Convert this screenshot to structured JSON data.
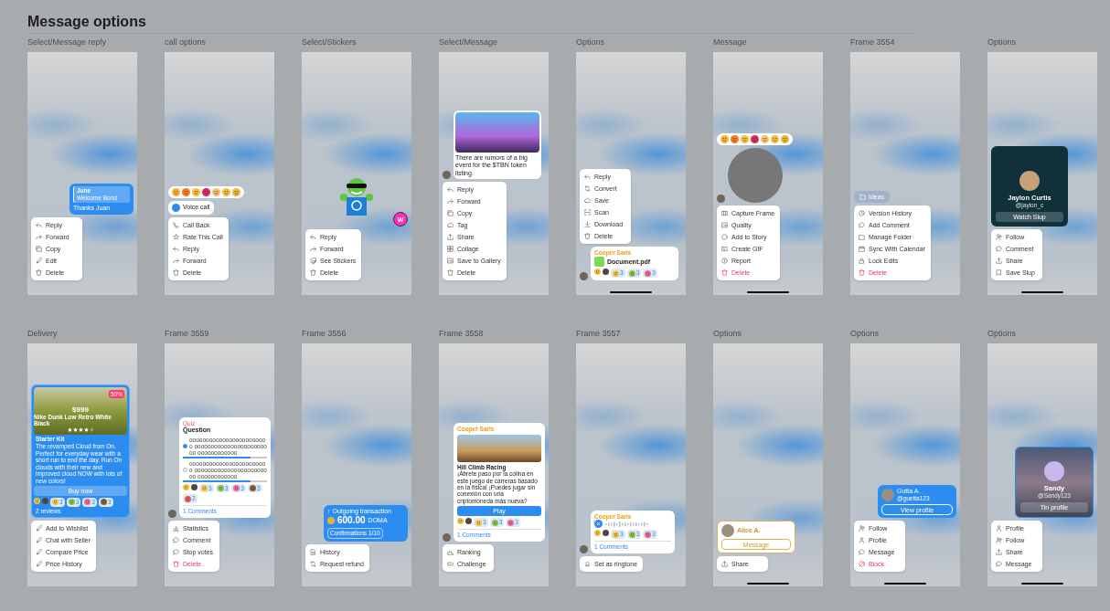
{
  "title": "Message options",
  "frames": [
    {
      "label": "Select/Message reply",
      "home_indicator": false,
      "parts": [
        {
          "kind": "reply-bubble",
          "outgoing": true,
          "quote_name": "June",
          "quote_text": "Welcome Bond",
          "text": "Thanks Juan"
        },
        {
          "kind": "menu",
          "items": [
            {
              "kind": "reply",
              "label": "Reply",
              "danger": false
            },
            {
              "kind": "forward",
              "label": "Forward",
              "danger": false
            },
            {
              "kind": "copy",
              "label": "Copy",
              "danger": false
            },
            {
              "kind": "edit",
              "label": "Edit",
              "danger": false
            },
            {
              "kind": "delete",
              "label": "Delete",
              "danger": false
            }
          ]
        }
      ]
    },
    {
      "label": "call options",
      "home_indicator": false,
      "parts": [
        {
          "kind": "reaction-bar",
          "emojis": [
            {
              "color": "#f7b733"
            },
            {
              "color": "#f57c1f"
            },
            {
              "color": "#f9c23c"
            },
            {
              "color": "#e0245e"
            },
            {
              "color": "#f5c26b"
            },
            {
              "color": "#f4c04a"
            },
            {
              "color": "#f2b63a"
            }
          ]
        },
        {
          "kind": "call-bubble",
          "outgoing": false,
          "text": "Voice call"
        },
        {
          "kind": "menu",
          "items": [
            {
              "kind": "call",
              "label": "Call Back",
              "danger": false
            },
            {
              "kind": "star",
              "label": "Rate This Call",
              "danger": false
            },
            {
              "kind": "reply",
              "label": "Reply",
              "danger": false
            },
            {
              "kind": "forward",
              "label": "Forward",
              "danger": false
            },
            {
              "kind": "delete",
              "label": "Delete",
              "danger": false
            }
          ]
        }
      ]
    },
    {
      "label": "Select/Stickers",
      "home_indicator": false,
      "parts": [
        {
          "kind": "sticker",
          "badge": "W"
        },
        {
          "kind": "menu",
          "items": [
            {
              "kind": "reply",
              "label": "Reply",
              "danger": false
            },
            {
              "kind": "forward",
              "label": "Forward",
              "danger": false
            },
            {
              "kind": "sticker",
              "label": "See Stickers",
              "danger": false
            },
            {
              "kind": "delete",
              "label": "Delete",
              "danger": false
            }
          ]
        }
      ]
    },
    {
      "label": "Select/Message",
      "home_indicator": false,
      "parts": [
        {
          "kind": "image-message",
          "outgoing": false,
          "text": "There are rumors of a big event for the $TBN token listing."
        },
        {
          "kind": "menu",
          "items": [
            {
              "kind": "reply",
              "label": "Reply",
              "danger": false
            },
            {
              "kind": "forward",
              "label": "Forward",
              "danger": false
            },
            {
              "kind": "copy",
              "label": "Copy",
              "danger": false
            },
            {
              "kind": "cloud",
              "label": "Tag",
              "danger": false
            },
            {
              "kind": "share",
              "label": "Share",
              "danger": false
            },
            {
              "kind": "collage",
              "label": "Collage",
              "danger": false
            },
            {
              "kind": "gallery",
              "label": "Save to Gallery",
              "danger": false
            },
            {
              "kind": "delete",
              "label": "Delete",
              "danger": false
            }
          ]
        }
      ]
    },
    {
      "label": "Options",
      "home_indicator": true,
      "parts": [
        {
          "kind": "menu",
          "items": [
            {
              "kind": "reply",
              "label": "Reply",
              "danger": false
            },
            {
              "kind": "convert",
              "label": "Convert",
              "danger": false
            },
            {
              "kind": "cloud",
              "label": "Save",
              "danger": false
            },
            {
              "kind": "scan",
              "label": "Scan",
              "danger": false
            },
            {
              "kind": "download",
              "label": "Download",
              "danger": false
            },
            {
              "kind": "delete",
              "label": "Delete",
              "danger": false
            }
          ]
        },
        {
          "kind": "file-message",
          "outgoing": false,
          "sender": "Cooper Saris",
          "file": "Document.pdf",
          "reactions": [
            {
              "color": "#f6c343"
            },
            {
              "color": "#4a4a4a"
            },
            {
              "color": "#f6c343",
              "count": "3"
            },
            {
              "color": "#8bc34a",
              "count": "3"
            },
            {
              "color": "#f06a9a",
              "count": "3"
            }
          ]
        }
      ]
    },
    {
      "label": "Message",
      "home_indicator": true,
      "parts": [
        {
          "kind": "reaction-bar",
          "emojis": [
            {
              "color": "#f7b733"
            },
            {
              "color": "#f57c1f"
            },
            {
              "color": "#f9c23c"
            },
            {
              "color": "#e0245e"
            },
            {
              "color": "#f5c26b"
            },
            {
              "color": "#f4c04a"
            },
            {
              "color": "#f2b63a"
            }
          ]
        },
        {
          "kind": "round-video"
        },
        {
          "kind": "menu",
          "items": [
            {
              "kind": "frame",
              "label": "Capture Frame",
              "danger": false
            },
            {
              "kind": "gallery",
              "label": "Quality",
              "danger": false
            },
            {
              "kind": "circle",
              "label": "Add to Story",
              "danger": false
            },
            {
              "kind": "gif",
              "label": "Create GIF",
              "danger": false
            },
            {
              "kind": "report",
              "label": "Report",
              "danger": false
            },
            {
              "kind": "delete",
              "label": "Delete",
              "danger": true
            }
          ]
        }
      ]
    },
    {
      "label": "Frame 3554",
      "home_indicator": false,
      "parts": [
        {
          "kind": "folder-chip",
          "text": "Ideas"
        },
        {
          "kind": "menu",
          "items": [
            {
              "kind": "history",
              "label": "Version History",
              "danger": false
            },
            {
              "kind": "comment",
              "label": "Add Comment",
              "danger": false
            },
            {
              "kind": "folder",
              "label": "Manage Folder",
              "danger": false
            },
            {
              "kind": "calendar",
              "label": "Sync With Calendar",
              "danger": false
            },
            {
              "kind": "lock",
              "label": "Lock Edits",
              "danger": false
            },
            {
              "kind": "delete",
              "label": "Delete",
              "danger": true
            }
          ]
        }
      ]
    },
    {
      "label": "Options",
      "home_indicator": true,
      "parts": [
        {
          "kind": "profile-card",
          "outgoing": false,
          "name": "Jaylon Curtis",
          "handle": "@jaylon_c",
          "button": "Watch Slup"
        },
        {
          "kind": "menu",
          "items": [
            {
              "kind": "follow",
              "label": "Follow",
              "danger": false
            },
            {
              "kind": "comment",
              "label": "Comment",
              "danger": false
            },
            {
              "kind": "share",
              "label": "Share",
              "danger": false
            },
            {
              "kind": "bookmark",
              "label": "Save Slup",
              "danger": false
            }
          ]
        }
      ]
    },
    {
      "label": "Delivery",
      "home_indicator": false,
      "parts": [
        {
          "kind": "product-card",
          "discount": "50%",
          "price": "$999",
          "name": "Nike Dunk Low Retro White Black",
          "stars": 4,
          "subtitle": "Starter Kit",
          "text": "The revamped Cloud from On. Perfect for everyday wear with a short run to end the day. Run On clouds with their new and improved cloud NOW with lots of new colors!",
          "button": "Buy now",
          "reactions": [
            {
              "color": "#f6c343"
            },
            {
              "color": "#4a4a4a"
            },
            {
              "color": "#f6c343",
              "count": "3"
            },
            {
              "color": "#8bc34a",
              "count": "3"
            },
            {
              "color": "#f06a9a",
              "count": "3"
            },
            {
              "color": "#8d5a3b",
              "count": "3"
            }
          ],
          "footer": "2 reviews"
        },
        {
          "kind": "menu",
          "items": [
            {
              "kind": "edit",
              "label": "Add to Wishlist",
              "danger": false
            },
            {
              "kind": "edit",
              "label": "Chat with Seller",
              "danger": false
            },
            {
              "kind": "edit",
              "label": "Compare Price",
              "danger": false
            },
            {
              "kind": "edit",
              "label": "Price History",
              "danger": false
            }
          ]
        }
      ]
    },
    {
      "label": "Frame 3559",
      "home_indicator": false,
      "parts": [
        {
          "kind": "poll",
          "outgoing": false,
          "tag": "Quiz",
          "question": "Question",
          "options": [
            {
              "text": "oooooooooooooooooooooooo oooooooooooooooooooooooo oooooooooooo",
              "selected": true,
              "level": 0.8
            },
            {
              "text": "oooooooooooooooooooooooo oooooooooooooooooooooooo oooooooooooo",
              "selected": false,
              "level": 0.8
            }
          ],
          "reactions": [
            {
              "color": "#f6c343"
            },
            {
              "color": "#4a4a4a"
            },
            {
              "color": "#f6c343",
              "count": "3"
            },
            {
              "color": "#8bc34a",
              "count": "3"
            },
            {
              "color": "#f06a9a",
              "count": "3"
            },
            {
              "color": "#8d5a3b",
              "count": "3"
            },
            {
              "color": "#e55b5b",
              "count": "2"
            }
          ],
          "comments": "1 Comments"
        },
        {
          "kind": "menu",
          "items": [
            {
              "kind": "stats",
              "label": "Statistics",
              "danger": false
            },
            {
              "kind": "comment",
              "label": "Comment",
              "danger": false
            },
            {
              "kind": "comment",
              "label": "Stop votes",
              "danger": false
            },
            {
              "kind": "delete",
              "label": "Delete",
              "danger": true
            }
          ]
        }
      ]
    },
    {
      "label": "Frame 3556",
      "home_indicator": false,
      "parts": [
        {
          "kind": "transaction",
          "outgoing": true,
          "heading": "↑ Outgoing transaction",
          "amount": "600.00",
          "currency": "DOMA",
          "confirmations": "Confirmations 1/10"
        },
        {
          "kind": "menu",
          "items": [
            {
              "kind": "document",
              "label": "History",
              "danger": false
            },
            {
              "kind": "convert",
              "label": "Request refund",
              "danger": false
            }
          ]
        }
      ]
    },
    {
      "label": "Frame 3558",
      "home_indicator": false,
      "parts": [
        {
          "kind": "game-card",
          "outgoing": false,
          "sender": "Cooper Saris",
          "title": "Hill Climb Racing",
          "text": "¡Ábrete paso por la colina en este juego de carreras basado en la física! ¡Puedes jugar sin conexión con una criptomoneda más nueva?",
          "button": "Play",
          "reactions": [
            {
              "color": "#f6c343"
            },
            {
              "color": "#4a4a4a"
            },
            {
              "color": "#f6c343",
              "count": "3"
            },
            {
              "color": "#8bc34a",
              "count": "3"
            },
            {
              "color": "#f06a9a",
              "count": "3"
            }
          ],
          "comments": "1 Comments"
        },
        {
          "kind": "menu",
          "items": [
            {
              "kind": "podium",
              "label": "Ranking",
              "danger": false
            },
            {
              "kind": "gamepad",
              "label": "Challenge",
              "danger": false
            }
          ]
        }
      ]
    },
    {
      "label": "Frame 3557",
      "home_indicator": false,
      "parts": [
        {
          "kind": "voice-message",
          "outgoing": false,
          "sender": "Cooper Saris",
          "reactions": [
            {
              "color": "#f6c343"
            },
            {
              "color": "#4a4a4a"
            },
            {
              "color": "#f6c343",
              "count": "3"
            },
            {
              "color": "#8bc34a",
              "count": "3"
            },
            {
              "color": "#f06a9a",
              "count": "3"
            }
          ],
          "comments": "1 Comments"
        },
        {
          "kind": "menu",
          "items": [
            {
              "kind": "bell",
              "label": "Set as ringtone",
              "danger": false
            }
          ]
        }
      ]
    },
    {
      "label": "Options",
      "home_indicator": true,
      "parts": [
        {
          "kind": "contact-card",
          "outgoing": false,
          "name": "Alice A.",
          "button": "Message"
        },
        {
          "kind": "menu",
          "items": [
            {
              "kind": "share",
              "label": "Share",
              "danger": false
            }
          ]
        }
      ]
    },
    {
      "label": "Options",
      "home_indicator": true,
      "parts": [
        {
          "kind": "contact-bubble",
          "outgoing": true,
          "name": "Gutta A.",
          "handle": "@guetta123",
          "button": "View profile"
        },
        {
          "kind": "menu",
          "items": [
            {
              "kind": "follow",
              "label": "Follow",
              "danger": false
            },
            {
              "kind": "profile",
              "label": "Profile",
              "danger": false
            },
            {
              "kind": "comment",
              "label": "Message",
              "danger": false
            },
            {
              "kind": "block",
              "label": "Block",
              "danger": true
            }
          ]
        }
      ]
    },
    {
      "label": "Options",
      "home_indicator": true,
      "parts": [
        {
          "kind": "profile-card",
          "outgoing": true,
          "name": "Sandy",
          "handle": "@Sandy123",
          "button": "Tin profile"
        },
        {
          "kind": "menu",
          "items": [
            {
              "kind": "profile",
              "label": "Profile",
              "danger": false
            },
            {
              "kind": "follow",
              "label": "Follow",
              "danger": false
            },
            {
              "kind": "share",
              "label": "Share",
              "danger": false
            },
            {
              "kind": "comment",
              "label": "Message",
              "danger": false
            }
          ]
        }
      ]
    }
  ]
}
